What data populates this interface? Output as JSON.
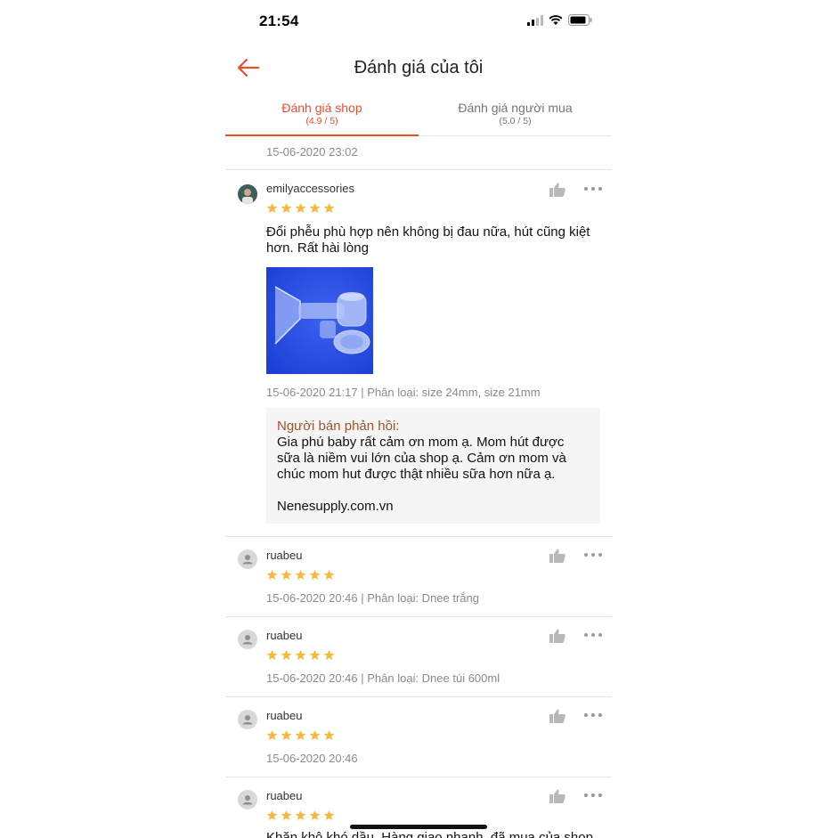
{
  "status_bar": {
    "time": "21:54"
  },
  "header": {
    "title": "Đánh giá của tôi",
    "back_icon": "arrow-left-icon"
  },
  "tabs": [
    {
      "label": "Đánh giá shop",
      "rating": "(4.9 / 5)",
      "active": true
    },
    {
      "label": "Đánh giá người mua",
      "rating": "(5.0 / 5)",
      "active": false
    }
  ],
  "top_item": {
    "timestamp": "15-06-2020 23:02"
  },
  "reviews": [
    {
      "username": "emilyaccessories",
      "stars": 5,
      "comment": "Đổi phễu phù hợp nên không bị đau nữa, hút cũng kiệt hơn. Rất hài lòng",
      "meta": "15-06-2020 21:17 | Phân loại: size 24mm, size 21mm",
      "reply": {
        "heading": "Người bán phản hồi:",
        "body": "Gia phú baby rất cảm ơn mom ạ. Mom hút được sữa là niềm vui lớn của shop ạ. Cảm ơn mom và chúc mom hut được thật nhiều sữa hơn nữa ạ.",
        "signature": "Nenesupply.com.vn"
      }
    },
    {
      "username": "ruabeu",
      "stars": 5,
      "meta": "15-06-2020 20:46 | Phân loại: Dnee trắng"
    },
    {
      "username": "ruabeu",
      "stars": 5,
      "meta": "15-06-2020 20:46 | Phân loại: Dnee túi 600ml"
    },
    {
      "username": "ruabeu",
      "stars": 5,
      "meta": "15-06-2020 20:46"
    },
    {
      "username": "ruabeu",
      "stars": 5,
      "comment_partial": "Khăn khô khó dầu. Hàng giao nhanh, đã mua của shop"
    }
  ],
  "colors": {
    "accent": "#ee4d2d",
    "star": "#f6b93b",
    "reply_heading": "#a0522d"
  },
  "icons": [
    "arrow-left-icon",
    "thumbs-up-icon",
    "more-dots-icon",
    "star-icon",
    "user-avatar-icon",
    "wifi-icon",
    "battery-icon",
    "signal-icon"
  ]
}
